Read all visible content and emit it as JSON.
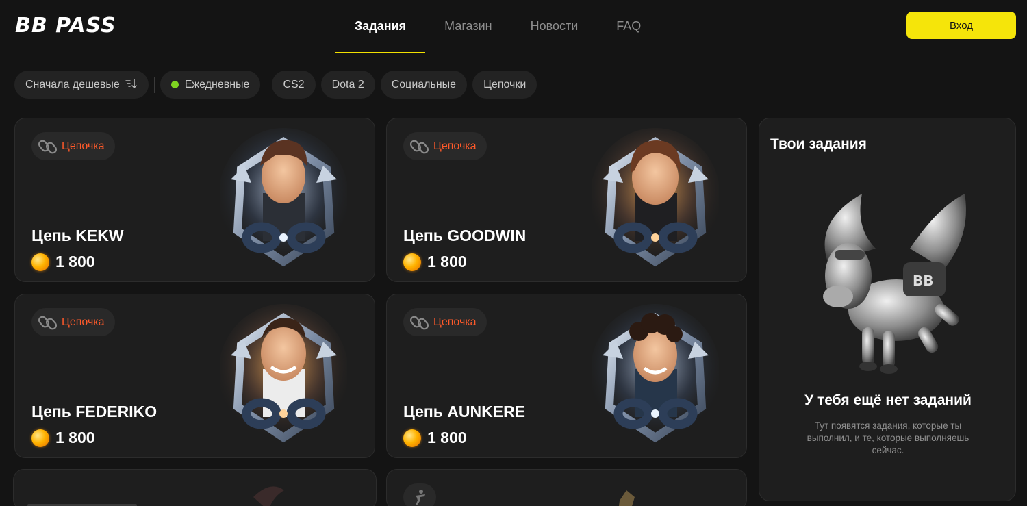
{
  "header": {
    "logo": "BB PASS",
    "nav": [
      {
        "label": "Задания",
        "active": true
      },
      {
        "label": "Магазин",
        "active": false
      },
      {
        "label": "Новости",
        "active": false
      },
      {
        "label": "FAQ",
        "active": false
      }
    ],
    "login_label": "Вход"
  },
  "filters": {
    "sort_label": "Сначала дешевые",
    "daily_label": "Ежедневные",
    "chips": [
      "CS2",
      "Dota 2",
      "Социальные",
      "Цепочки"
    ]
  },
  "cards": [
    {
      "tag": "Цепочка",
      "title": "Цепь KEKW",
      "price": "1 800"
    },
    {
      "tag": "Цепочка",
      "title": "Цепь GOODWIN",
      "price": "1 800"
    },
    {
      "tag": "Цепочка",
      "title": "Цепь FEDERIKO",
      "price": "1 800"
    },
    {
      "tag": "Цепочка",
      "title": "Цепь AUNKERE",
      "price": "1 800"
    }
  ],
  "sidebar": {
    "title": "Твои задания",
    "empty_title": "У тебя ещё нет заданий",
    "empty_desc": "Тут появятся задания, которые ты выполнил, и те, которые выполняешь сейчас."
  },
  "colors": {
    "accent_yellow": "#f5e50a",
    "tag_orange": "#ff5a2a",
    "daily_green": "#7ed321",
    "background": "#141414",
    "card_bg": "#1e1e1e"
  }
}
